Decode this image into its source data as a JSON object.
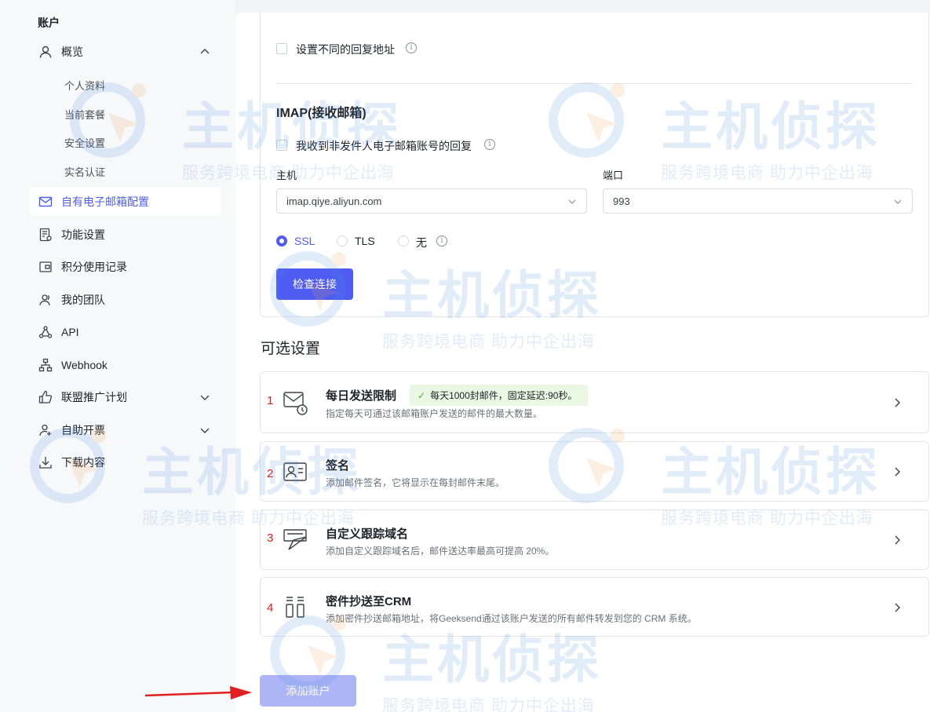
{
  "sidebar": {
    "title": "账户",
    "overview": "概览",
    "sub_items": [
      "个人资料",
      "当前套餐",
      "安全设置",
      "实名认证"
    ],
    "items": [
      {
        "label": "自有电子邮箱配置",
        "icon": "mail-icon"
      },
      {
        "label": "功能设置",
        "icon": "settings-doc-icon"
      },
      {
        "label": "积分使用记录",
        "icon": "wallet-icon"
      },
      {
        "label": "我的团队",
        "icon": "team-icon"
      },
      {
        "label": "API",
        "icon": "api-icon"
      },
      {
        "label": "Webhook",
        "icon": "webhook-icon"
      },
      {
        "label": "联盟推广计划",
        "icon": "thumbs-up-icon"
      },
      {
        "label": "自助开票",
        "icon": "invoice-user-icon"
      },
      {
        "label": "下载内容",
        "icon": "download-icon"
      }
    ]
  },
  "form": {
    "reply_address_label": "设置不同的回复地址",
    "imap_heading": "IMAP(接收邮箱)",
    "non_sender_reply_label": "我收到非发件人电子邮箱账号的回复",
    "host_label": "主机",
    "host_value": "imap.qiye.aliyun.com",
    "port_label": "端口",
    "port_value": "993",
    "security_options": [
      "SSL",
      "TLS",
      "无"
    ],
    "security_selected": "SSL",
    "check_button": "检查连接"
  },
  "optional": {
    "heading": "可选设置",
    "cards": [
      {
        "num": "1",
        "title": "每日发送限制",
        "badge": "每天1000封邮件，固定延迟:90秒。",
        "desc": "指定每天可通过该邮箱账户发送的邮件的最大数量。",
        "icon": "mail-clock-icon"
      },
      {
        "num": "2",
        "title": "签名",
        "desc": "添加邮件签名，它将显示在每封邮件末尾。",
        "icon": "id-card-icon"
      },
      {
        "num": "3",
        "title": "自定义跟踪域名",
        "desc": "添加自定义跟踪域名后，邮件送达率最高可提高 20%。",
        "icon": "send-tracking-icon"
      },
      {
        "num": "4",
        "title": "密件抄送至CRM",
        "desc": "添加密件抄送邮箱地址，将Geeksend通过该账户发送的所有邮件转发到您的 CRM 系统。",
        "icon": "bcc-crm-icon"
      }
    ]
  },
  "add_button": "添加账户",
  "watermark": {
    "big": "主机侦探",
    "small": "服务跨境电商 助力中企出海"
  },
  "colors": {
    "accent": "#4e5cf2",
    "annotation_red": "#e02020",
    "badge_bg": "#e9f7e3"
  }
}
